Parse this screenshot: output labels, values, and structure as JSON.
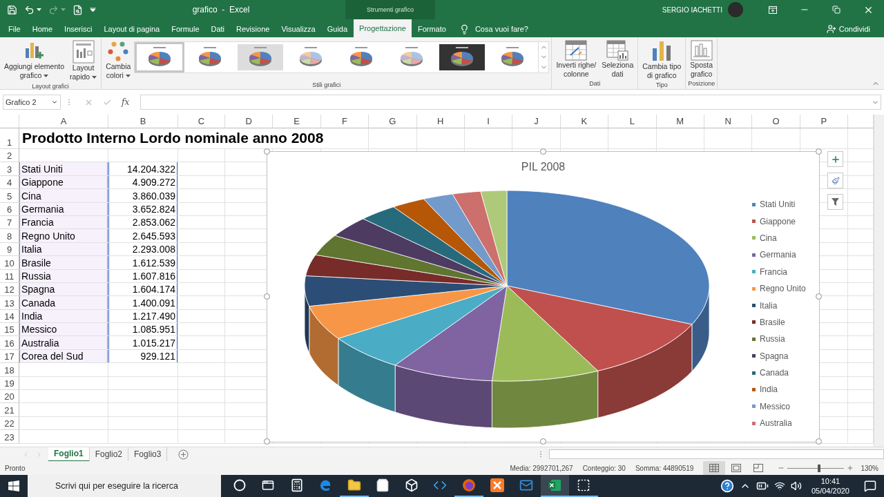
{
  "title_bar": {
    "title": "grafico  -  Excel",
    "context_label": "Strumenti grafico",
    "user": "SERGIO IACHETTI",
    "quick_access": [
      {
        "kind": "save",
        "disabled": false
      },
      {
        "kind": "undo",
        "disabled": false
      },
      {
        "kind": "redo",
        "disabled": true
      },
      {
        "kind": "preview",
        "disabled": false
      },
      {
        "kind": "customize",
        "disabled": false
      }
    ]
  },
  "menu_tabs": [
    {
      "label": "File",
      "selected": false
    },
    {
      "label": "Home",
      "selected": false
    },
    {
      "label": "Inserisci",
      "selected": false
    },
    {
      "label": "Layout di pagina",
      "selected": false
    },
    {
      "label": "Formule",
      "selected": false
    },
    {
      "label": "Dati",
      "selected": false
    },
    {
      "label": "Revisione",
      "selected": false
    },
    {
      "label": "Visualizza",
      "selected": false
    },
    {
      "label": "Guida",
      "selected": false
    },
    {
      "label": "Progettazione",
      "selected": true
    },
    {
      "label": "Formato",
      "selected": false
    }
  ],
  "tell_me": {
    "placeholder": "Cosa vuoi fare?"
  },
  "share": "Condividi",
  "ribbon": {
    "groups": [
      {
        "label": "Layout grafici",
        "items": [
          {
            "kind": "button",
            "lines": [
              "Aggiungi elemento",
              "grafico"
            ],
            "dropdown": true
          },
          {
            "kind": "button",
            "lines": [
              "Layout",
              "rapido"
            ],
            "dropdown": true
          }
        ]
      },
      {
        "label": "Stili grafici",
        "items": [
          {
            "kind": "button",
            "lines": [
              "Cambia",
              "colori"
            ],
            "dropdown": true
          },
          {
            "kind": "gallery",
            "styles": [
              {
                "selected": true
              },
              {
                "selected": false
              },
              {
                "selected": false
              },
              {
                "selected": false
              },
              {
                "selected": false
              },
              {
                "selected": false
              },
              {
                "selected": false
              },
              {
                "selected": false
              }
            ]
          }
        ]
      },
      {
        "label": "Dati",
        "items": [
          {
            "kind": "button",
            "lines": [
              "Inverti righe/",
              "colonne"
            ],
            "dropdown": false
          },
          {
            "kind": "button",
            "lines": [
              "Seleziona",
              "dati"
            ],
            "dropdown": false
          }
        ]
      },
      {
        "label": "Tipo",
        "items": [
          {
            "kind": "button",
            "lines": [
              "Cambia tipo",
              "di grafico"
            ],
            "dropdown": false
          }
        ]
      },
      {
        "label": "Posizione",
        "items": [
          {
            "kind": "button",
            "lines": [
              "Sposta",
              "grafico"
            ],
            "dropdown": false
          }
        ]
      }
    ]
  },
  "formula_bar": {
    "name_box": "Grafico 2",
    "function_label": "fx"
  },
  "sheet": {
    "columns": [
      "A",
      "B",
      "C",
      "D",
      "E",
      "F",
      "G",
      "H",
      "I",
      "J",
      "K",
      "L",
      "M",
      "N",
      "O",
      "P"
    ],
    "rows": [
      "1",
      "2",
      "3",
      "4",
      "5",
      "6",
      "7",
      "8",
      "9",
      "10",
      "11",
      "12",
      "13",
      "14",
      "15",
      "16",
      "17",
      "18",
      "19",
      "20",
      "21",
      "22",
      "23"
    ],
    "title_cell": "Prodotto Interno Lordo nominale anno 2008",
    "data": [
      {
        "country": "Stati Uniti",
        "value": "14.204.322"
      },
      {
        "country": "Giappone",
        "value": "4.909.272"
      },
      {
        "country": "Cina",
        "value": "3.860.039"
      },
      {
        "country": "Germania",
        "value": "3.652.824"
      },
      {
        "country": "Francia",
        "value": "2.853.062"
      },
      {
        "country": "Regno Unito",
        "value": "2.645.593"
      },
      {
        "country": "Italia",
        "value": "2.293.008"
      },
      {
        "country": "Brasile",
        "value": "1.612.539"
      },
      {
        "country": "Russia",
        "value": "1.607.816"
      },
      {
        "country": "Spagna",
        "value": "1.604.174"
      },
      {
        "country": "Canada",
        "value": "1.400.091"
      },
      {
        "country": "India",
        "value": "1.217.490"
      },
      {
        "country": "Messico",
        "value": "1.085.951"
      },
      {
        "country": "Australia",
        "value": "1.015.217"
      },
      {
        "country": "Corea del Sud",
        "value": "929.121"
      }
    ]
  },
  "chart": {
    "selected": true,
    "title": "PIL 2008",
    "legend": [
      {
        "label": "Stati Uniti",
        "color": "#4f81bd"
      },
      {
        "label": "Giappone",
        "color": "#c0504d"
      },
      {
        "label": "Cina",
        "color": "#9bbb59"
      },
      {
        "label": "Germania",
        "color": "#8064a2"
      },
      {
        "label": "Francia",
        "color": "#4bacc6"
      },
      {
        "label": "Regno Unito",
        "color": "#f79646"
      },
      {
        "label": "Italia",
        "color": "#2c4d75"
      },
      {
        "label": "Brasile",
        "color": "#772c2a"
      },
      {
        "label": "Russia",
        "color": "#5f7530"
      },
      {
        "label": "Spagna",
        "color": "#4d3b62"
      },
      {
        "label": "Canada",
        "color": "#276a7c"
      },
      {
        "label": "India",
        "color": "#b65708"
      },
      {
        "label": "Messico",
        "color": "#729aca"
      },
      {
        "label": "Australia",
        "color": "#cd6f6c"
      }
    ]
  },
  "sheet_tabs": [
    {
      "label": "Foglio1",
      "selected": true
    },
    {
      "label": "Foglio2",
      "selected": false
    },
    {
      "label": "Foglio3",
      "selected": false
    }
  ],
  "status_bar": {
    "mode": "Pronto",
    "stats": [
      "Media: 2992701,267",
      "Conteggio: 30",
      "Somma: 44890519"
    ],
    "views": [
      {
        "kind": "normal",
        "selected": true
      },
      {
        "kind": "page-layout",
        "selected": false
      },
      {
        "kind": "page-break",
        "selected": false
      }
    ],
    "zoom": {
      "level": 0.56,
      "label": "130%"
    }
  },
  "taskbar": {
    "search": {
      "placeholder": "Scrivi qui per eseguire la ricerca"
    },
    "apps": [
      {
        "kind": "cortana",
        "open": false,
        "active": false
      },
      {
        "kind": "taskview",
        "open": false,
        "active": false
      },
      {
        "kind": "calculator",
        "open": false,
        "active": false
      },
      {
        "kind": "edge",
        "open": false,
        "active": false
      },
      {
        "kind": "explorer",
        "open": true,
        "active": false
      },
      {
        "kind": "store",
        "open": false,
        "active": false
      },
      {
        "kind": "dropbox",
        "open": false,
        "active": false
      },
      {
        "kind": "code",
        "open": false,
        "active": false
      },
      {
        "kind": "firefox",
        "open": true,
        "active": false
      },
      {
        "kind": "xampp",
        "open": false,
        "active": false
      },
      {
        "kind": "mail",
        "open": false,
        "active": false
      },
      {
        "kind": "excel",
        "open": true,
        "active": true
      },
      {
        "kind": "snip",
        "open": true,
        "active": false
      }
    ],
    "tray": [
      {
        "kind": "help"
      },
      {
        "kind": "chevron"
      },
      {
        "kind": "battery"
      },
      {
        "kind": "wifi"
      },
      {
        "kind": "volume"
      }
    ],
    "time": "10:41",
    "date": "05/04/2020"
  }
}
